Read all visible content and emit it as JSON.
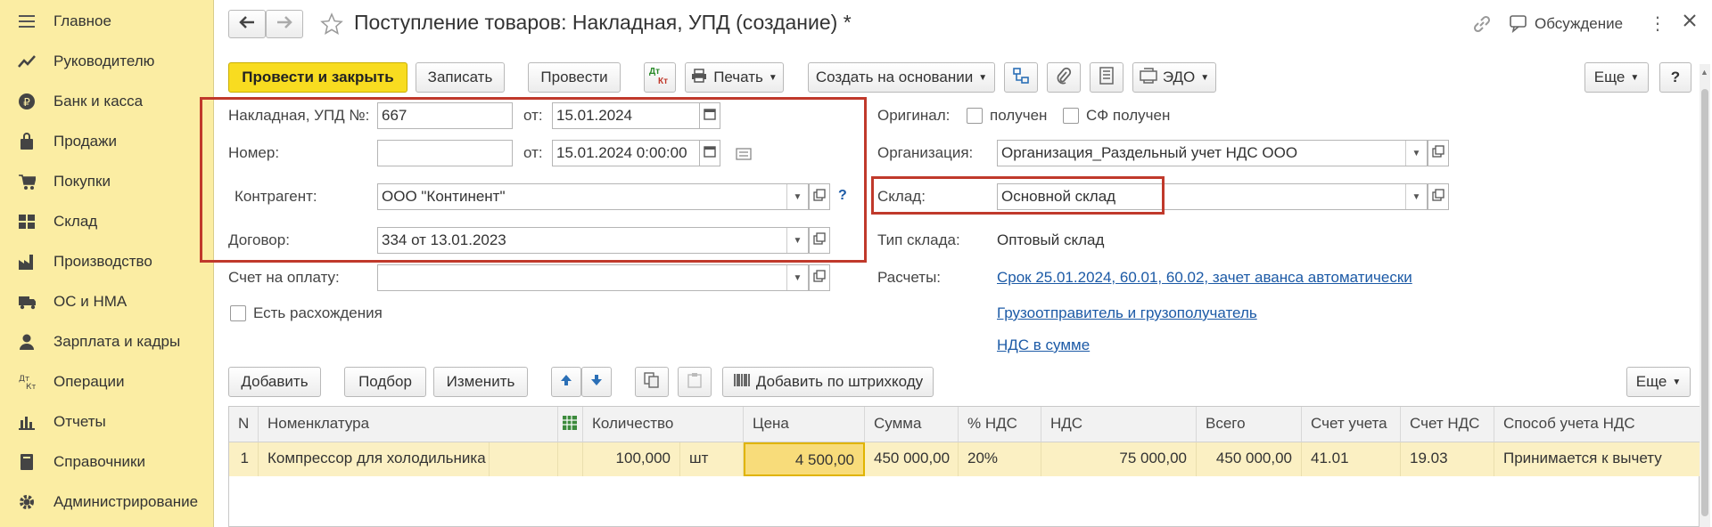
{
  "sidebar": {
    "items": [
      {
        "label": "Главное",
        "icon": "menu-icon"
      },
      {
        "label": "Руководителю",
        "icon": "chart-line-icon"
      },
      {
        "label": "Банк и касса",
        "icon": "ruble-coin-icon"
      },
      {
        "label": "Продажи",
        "icon": "shopping-bag-icon"
      },
      {
        "label": "Покупки",
        "icon": "cart-icon"
      },
      {
        "label": "Склад",
        "icon": "warehouse-grid-icon"
      },
      {
        "label": "Производство",
        "icon": "factory-icon"
      },
      {
        "label": "ОС и НМА",
        "icon": "truck-icon"
      },
      {
        "label": "Зарплата и кадры",
        "icon": "person-icon"
      },
      {
        "label": "Операции",
        "icon": "debit-credit-icon"
      },
      {
        "label": "Отчеты",
        "icon": "bar-chart-icon"
      },
      {
        "label": "Справочники",
        "icon": "book-icon"
      },
      {
        "label": "Администрирование",
        "icon": "gear-icon"
      }
    ]
  },
  "header": {
    "title": "Поступление товаров: Накладная, УПД (создание) *",
    "discussion_label": "Обсуждение"
  },
  "toolbar": {
    "post_close": "Провести и закрыть",
    "save": "Записать",
    "post": "Провести",
    "dtkt_top": "Дт",
    "dtkt_bottom": "Кт",
    "print": "Печать",
    "create_based": "Создать на основании",
    "edo": "ЭДО",
    "more": "Еще",
    "help": "?"
  },
  "form": {
    "invoice_label": "Накладная, УПД №:",
    "invoice_value": "667",
    "from_label": "от:",
    "invoice_date": "15.01.2024",
    "number_label": "Номер:",
    "number_value": "",
    "number_date": "15.01.2024  0:00:00",
    "counterparty_label": "Контрагент:",
    "counterparty_value": "ООО \"Континент\"",
    "contract_label": "Договор:",
    "contract_value": "334 от 13.01.2023",
    "payment_label": "Счет на оплату:",
    "payment_value": "",
    "discrepancy_label": "Есть расхождения",
    "original_label": "Оригинал:",
    "received_label": "получен",
    "sf_received_label": "СФ получен",
    "org_label": "Организация:",
    "org_value": "Организация_Раздельный учет НДС ООО",
    "warehouse_label": "Склад:",
    "warehouse_value": "Основной склад",
    "wh_type_label": "Тип склада:",
    "wh_type_value": "Оптовый склад",
    "settlements_label": "Расчеты:",
    "settlements_link": "Срок 25.01.2024, 60.01, 60.02, зачет аванса автоматически",
    "shipper_link": "Грузоотправитель и грузополучатель",
    "vat_link": "НДС в сумме",
    "help_mark": "?"
  },
  "table_toolbar": {
    "add": "Добавить",
    "pick": "Подбор",
    "change": "Изменить",
    "barcode": "Добавить по штрихкоду",
    "more": "Еще"
  },
  "table": {
    "headers": [
      "N",
      "Номенклатура",
      "Количество",
      "Цена",
      "Сумма",
      "% НДС",
      "НДС",
      "Всего",
      "Счет учета",
      "Счет НДС",
      "Способ учета НДС"
    ],
    "rows": [
      {
        "n": "1",
        "name": "Компрессор для холодильника",
        "qty": "100,000",
        "unit": "шт",
        "price": "4 500,00",
        "sum": "450 000,00",
        "vat_rate": "20%",
        "vat": "75 000,00",
        "total": "450 000,00",
        "account": "41.01",
        "vat_account": "19.03",
        "vat_method": "Принимается к вычету"
      }
    ]
  },
  "colors": {
    "sidebar_bg": "#fbeda3",
    "primary_button": "#f8dc20",
    "highlight_border": "#c0392b",
    "link": "#1c5aa6",
    "row_bg": "#fbf0c3"
  }
}
